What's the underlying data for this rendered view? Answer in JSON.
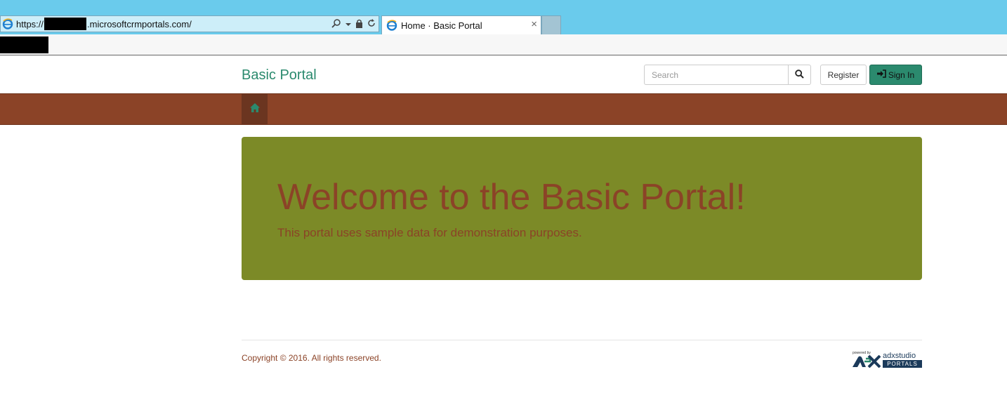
{
  "browser": {
    "url_prefix": "https://",
    "url_suffix": ".microsoftcrmportals.com/",
    "tab_title": "Home · Basic Portal",
    "tab_close": "×"
  },
  "header": {
    "brand": "Basic Portal",
    "search_placeholder": "Search",
    "register_label": "Register",
    "signin_label": "Sign In"
  },
  "hero": {
    "title": "Welcome to the Basic Portal!",
    "subtitle": "This portal uses sample data for demonstration purposes."
  },
  "footer": {
    "copyright": "Copyright © 2016. All rights reserved.",
    "logo_powered": "powered by",
    "logo_word": "adxstudio",
    "logo_portals": "PORTALS"
  },
  "colors": {
    "chrome": "#6acbec",
    "brand_green": "#2b8a6e",
    "nav_brown": "#8b4327",
    "hero_olive": "#7c8a27"
  },
  "icons": {
    "search": "search-icon",
    "home": "home-icon",
    "signin": "sign-in-icon",
    "browser": "ie-icon",
    "lock": "lock-icon",
    "refresh": "refresh-icon"
  }
}
